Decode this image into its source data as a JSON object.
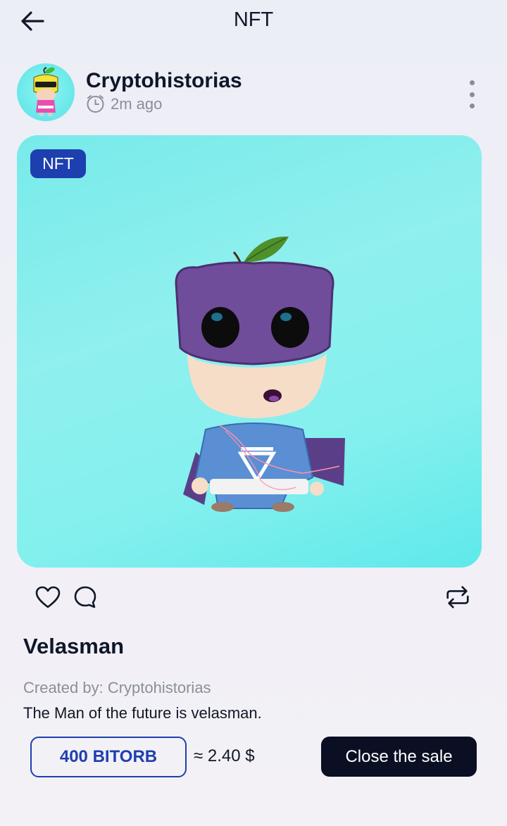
{
  "header": {
    "title": "NFT",
    "back_icon": "arrow-left-icon"
  },
  "post": {
    "author": "Cryptohistorias",
    "time": "2m ago",
    "time_icon": "clock-icon",
    "more_icon": "more-vertical-icon"
  },
  "nft": {
    "badge": "NFT",
    "title": "Velasman",
    "created_by": "Created by: Cryptohistorias",
    "description": "The Man of the future is velasman.",
    "price": "400 BITORB",
    "usd_value": "≈ 2.40 $"
  },
  "actions": {
    "like_icon": "heart-icon",
    "comment_icon": "comment-icon",
    "repost_icon": "repost-icon",
    "close_sale_label": "Close the sale"
  },
  "colors": {
    "accent": "#1e3faf",
    "dark_button": "#0b0f24",
    "card_background": "#84f0ee"
  }
}
